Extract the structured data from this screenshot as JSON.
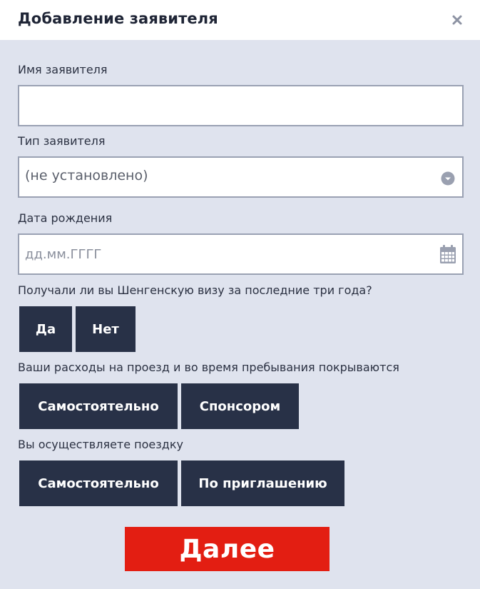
{
  "dialog": {
    "title": "Добавление заявителя",
    "close_icon": "close-icon"
  },
  "fields": {
    "name": {
      "label": "Имя заявителя",
      "value": "",
      "placeholder": ""
    },
    "type": {
      "label": "Тип заявителя",
      "selected": "(не установлено)",
      "icon": "chevron-down-icon"
    },
    "birthdate": {
      "label": "Дата рождения",
      "value": "",
      "placeholder": "дд.мм.ГГГГ",
      "icon": "calendar-icon"
    }
  },
  "questions": {
    "schengen": {
      "label": "Получали ли вы Шенгенскую визу за последние три года?",
      "options": [
        "Да",
        "Нет"
      ]
    },
    "expenses": {
      "label": "Ваши расходы на проезд и во время пребывания покрываются",
      "options": [
        "Самостоятельно",
        "Спонсором"
      ]
    },
    "trip": {
      "label": "Вы осуществляете поездку",
      "options": [
        "Самостоятельно",
        "По приглашению"
      ]
    }
  },
  "actions": {
    "next_label": "Далее"
  },
  "colors": {
    "background": "#dfe3ee",
    "header": "#ffffff",
    "dark_button": "#283147",
    "primary_button": "#e31e12",
    "input_border": "#9aa1b3"
  }
}
